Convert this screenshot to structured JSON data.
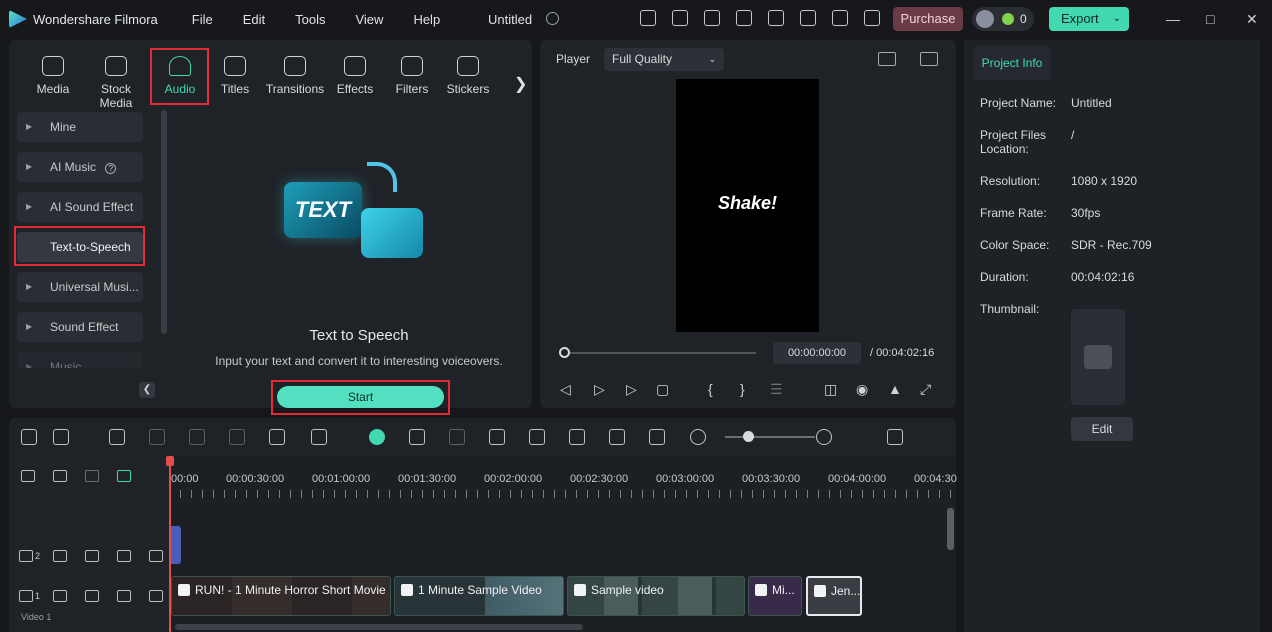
{
  "app": {
    "name": "Wondershare Filmora",
    "doc_title": "Untitled"
  },
  "menu": [
    "File",
    "Edit",
    "Tools",
    "View",
    "Help"
  ],
  "titlebar": {
    "purchase": "Purchase",
    "credits": "0",
    "export": "Export"
  },
  "tabs": [
    {
      "label": "Media"
    },
    {
      "label": "Stock Media"
    },
    {
      "label": "Audio"
    },
    {
      "label": "Titles"
    },
    {
      "label": "Transitions"
    },
    {
      "label": "Effects"
    },
    {
      "label": "Filters"
    },
    {
      "label": "Stickers"
    }
  ],
  "sidebar": [
    {
      "label": "Mine"
    },
    {
      "label": "AI Music"
    },
    {
      "label": "AI Sound Effect"
    },
    {
      "label": "Text-to-Speech"
    },
    {
      "label": "Universal Musi..."
    },
    {
      "label": "Sound Effect"
    },
    {
      "label": "Music"
    }
  ],
  "tts": {
    "title": "Text to Speech",
    "subtitle": "Input your text and convert it to interesting voiceovers.",
    "start": "Start",
    "card_text": "TEXT"
  },
  "player": {
    "label": "Player",
    "quality": "Full Quality",
    "preview_text": "Shake!",
    "current_time": "00:00:00:00",
    "total_time": "/ 00:04:02:16"
  },
  "project_info": {
    "tab": "Project Info",
    "rows": [
      {
        "k": "Project Name:",
        "v": "Untitled"
      },
      {
        "k": "Project Files Location:",
        "v": "/"
      },
      {
        "k": "Resolution:",
        "v": "1080 x 1920"
      },
      {
        "k": "Frame Rate:",
        "v": "30fps"
      },
      {
        "k": "Color Space:",
        "v": "SDR - Rec.709"
      },
      {
        "k": "Duration:",
        "v": "00:04:02:16"
      },
      {
        "k": "Thumbnail:",
        "v": ""
      }
    ],
    "edit": "Edit"
  },
  "timeline": {
    "ruler": [
      "00:00",
      "00:00:30:00",
      "00:01:00:00",
      "00:01:30:00",
      "00:02:00:00",
      "00:02:30:00",
      "00:03:00:00",
      "00:03:30:00",
      "00:04:00:00",
      "00:04:30"
    ],
    "tracks": [
      {
        "num": "2"
      },
      {
        "num": "1"
      }
    ],
    "video_label": "Video 1",
    "clips": [
      "RUN! - 1 Minute Horror Short Movie",
      "1 Minute Sample Video",
      "Sample video",
      "Mi...",
      "Jen..."
    ]
  }
}
